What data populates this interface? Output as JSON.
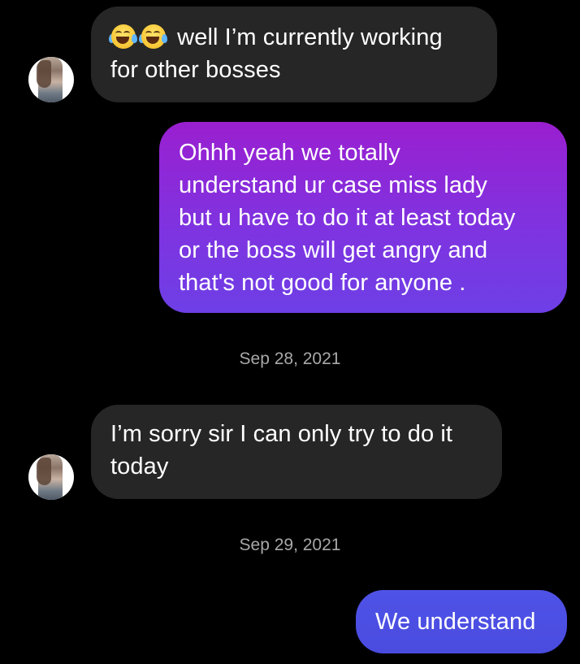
{
  "conversation": {
    "messages": [
      {
        "direction": "incoming",
        "emoji": "face-with-tears-of-joy",
        "lines": [
          "well I’m currently working",
          "for other bosses"
        ]
      },
      {
        "direction": "outgoing",
        "lines": [
          "Ohhh yeah we totally",
          "understand ur case miss lady",
          "but u have to do it at least today",
          "or the boss will get angry and",
          "that's not good for anyone ."
        ]
      },
      {
        "direction": "incoming",
        "lines": [
          "I’m sorry sir I can only try to do it",
          "today"
        ]
      },
      {
        "direction": "outgoing",
        "lines": [
          "We understand"
        ]
      }
    ],
    "dates": [
      "Sep 28, 2021",
      "Sep 29, 2021"
    ]
  },
  "colors": {
    "background": "#000000",
    "incoming_bubble": "#262626",
    "outgoing_bubble_purple": "#8a2be2",
    "outgoing_bubble_blue": "#4a4ce0",
    "date_text": "#a8a8a8"
  }
}
